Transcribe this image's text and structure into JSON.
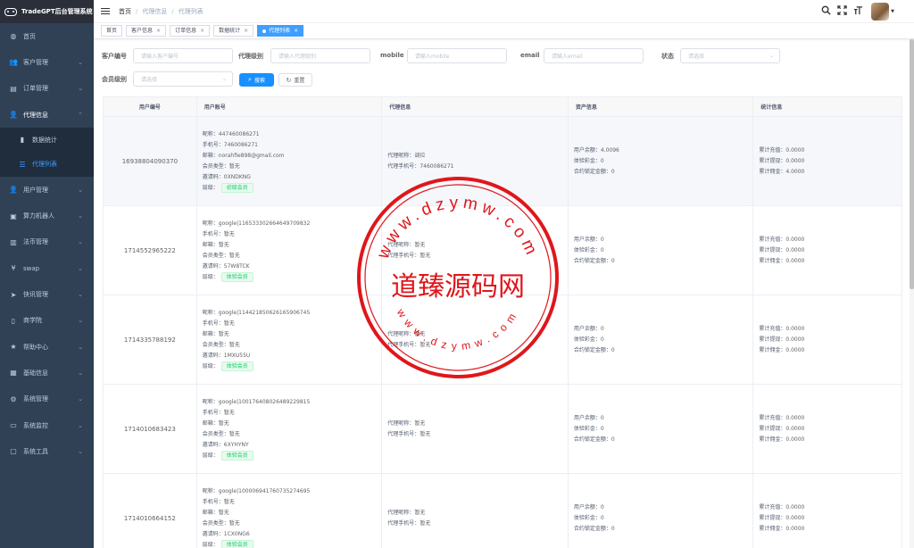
{
  "app": {
    "title": "TradeGPT后台管理系统"
  },
  "sidebar": {
    "items": [
      {
        "label": "首页",
        "icon": "dashboard-icon",
        "glyph": "◍"
      },
      {
        "label": "客户管理",
        "icon": "users-icon",
        "glyph": "👥"
      },
      {
        "label": "订单管理",
        "icon": "order-icon",
        "glyph": "▤"
      },
      {
        "label": "代理信息",
        "icon": "agent-icon",
        "glyph": "👤"
      },
      {
        "label": "用户管理",
        "icon": "user-icon",
        "glyph": "👤"
      },
      {
        "label": "算力机器人",
        "icon": "robot-icon",
        "glyph": "▣"
      },
      {
        "label": "法币管理",
        "icon": "fiat-icon",
        "glyph": "▥"
      },
      {
        "label": "swap",
        "icon": "yen-icon",
        "glyph": "¥"
      },
      {
        "label": "快讯管理",
        "icon": "send-icon",
        "glyph": "➤"
      },
      {
        "label": "商学院",
        "icon": "book-icon",
        "glyph": "▯"
      },
      {
        "label": "帮助中心",
        "icon": "star-icon",
        "glyph": "★"
      },
      {
        "label": "基础信息",
        "icon": "info-icon",
        "glyph": "▦"
      },
      {
        "label": "系统管理",
        "icon": "gear-icon",
        "glyph": "⚙"
      },
      {
        "label": "系统监控",
        "icon": "monitor-icon",
        "glyph": "▭"
      },
      {
        "label": "系统工具",
        "icon": "toolbox-icon",
        "glyph": "▢"
      }
    ],
    "agent_sub": [
      {
        "label": "数据统计",
        "icon": "bar-chart-icon",
        "glyph": "▮"
      },
      {
        "label": "代理列表",
        "icon": "list-icon",
        "glyph": "☰"
      }
    ]
  },
  "navbar": {
    "breadcrumb": [
      "首页",
      "代理信息",
      "代理列表"
    ]
  },
  "tags": [
    {
      "label": "首页",
      "closable": false,
      "active": false
    },
    {
      "label": "客户信息",
      "closable": true,
      "active": false
    },
    {
      "label": "订单信息",
      "closable": true,
      "active": false
    },
    {
      "label": "数据统计",
      "closable": true,
      "active": false
    },
    {
      "label": "代理列表",
      "closable": true,
      "active": true
    }
  ],
  "filters": {
    "customer_no": {
      "label": "客户编号",
      "placeholder": "请输入客户编号"
    },
    "agent_level": {
      "label": "代理级别",
      "placeholder": "请输入代理级别"
    },
    "mobile": {
      "label": "mobile",
      "placeholder": "请输入mobile"
    },
    "email": {
      "label": "email",
      "placeholder": "请输入email"
    },
    "status": {
      "label": "状态",
      "placeholder": "请选择"
    },
    "member_level": {
      "label": "会员级别",
      "placeholder": "请选择"
    },
    "search_label": "搜索",
    "reset_label": "重置"
  },
  "table": {
    "headers": [
      "用户编号",
      "用户账号",
      "代理信息",
      "资产信息",
      "统计信息"
    ],
    "field_labels": {
      "nickname": "昵称：",
      "phone": "手机号：",
      "email": "邮箱：",
      "member_type": "会员类型：",
      "invite_code": "邀请码：",
      "level": "层级：",
      "agent_nickname": "代理昵称：",
      "agent_phone": "代理手机号：",
      "balance": "用户余额：",
      "trial_bonus": "体验彩金：",
      "contract_locked": "合约锁定金额：",
      "total_recharge": "累计充值：",
      "total_withdraw": "累计提现：",
      "total_commission": "累计佣金："
    },
    "rows": [
      {
        "user_id": "16938804090370",
        "nickname": "447460086271",
        "phone": "7460086271",
        "email": "norahfie898@gmail.com",
        "member_type": "暂无",
        "invite_code": "0XNDKNG",
        "level": "初级会员",
        "agent_nickname": "调拉",
        "agent_phone": "7460086271",
        "balance": "4.0096",
        "trial_bonus": "0",
        "contract_locked": "0",
        "total_recharge": "0.0000",
        "total_withdraw": "0.0000",
        "total_commission": "4.0000"
      },
      {
        "user_id": "1714552965222",
        "nickname": "google|116533302664649709832",
        "phone": "暂无",
        "email": "暂无",
        "member_type": "暂无",
        "invite_code": "57W8TCK",
        "level": "体验会员",
        "agent_nickname": "暂无",
        "agent_phone": "暂无",
        "balance": "0",
        "trial_bonus": "0",
        "contract_locked": "0",
        "total_recharge": "0.0000",
        "total_withdraw": "0.0000",
        "total_commission": "0.0000"
      },
      {
        "user_id": "1714335788192",
        "nickname": "google|114421850626165906745",
        "phone": "暂无",
        "email": "暂无",
        "member_type": "暂无",
        "invite_code": "1MXU55U",
        "level": "体验会员",
        "agent_nickname": "暂无",
        "agent_phone": "暂无",
        "balance": "0",
        "trial_bonus": "0",
        "contract_locked": "0",
        "total_recharge": "0.0000",
        "total_withdraw": "0.0000",
        "total_commission": "0.0000"
      },
      {
        "user_id": "1714010683423",
        "nickname": "google|100176408026489229815",
        "phone": "暂无",
        "email": "暂无",
        "member_type": "暂无",
        "invite_code": "6XYHYNY",
        "level": "体验会员",
        "agent_nickname": "暂无",
        "agent_phone": "暂无",
        "balance": "0",
        "trial_bonus": "0",
        "contract_locked": "0",
        "total_recharge": "0.0000",
        "total_withdraw": "0.0000",
        "total_commission": "0.0000"
      },
      {
        "user_id": "1714010664152",
        "nickname": "google|100006941760735274695",
        "phone": "暂无",
        "email": "暂无",
        "member_type": "暂无",
        "invite_code": "1CX0NG6",
        "level": "体验会员",
        "agent_nickname": "暂无",
        "agent_phone": "暂无",
        "balance": "0",
        "trial_bonus": "0",
        "contract_locked": "0",
        "total_recharge": "0.0000",
        "total_withdraw": "0.0000",
        "total_commission": "0.0000"
      }
    ]
  },
  "watermark": {
    "title": "道臻源码网",
    "top_ring": "www.dzymw.com",
    "bottom_ring": "www.dzymw.com",
    "color": "#e0161b"
  },
  "colors": {
    "sidebar_bg": "#304156",
    "primary": "#1890ff",
    "tag_green": "#13ce66"
  }
}
